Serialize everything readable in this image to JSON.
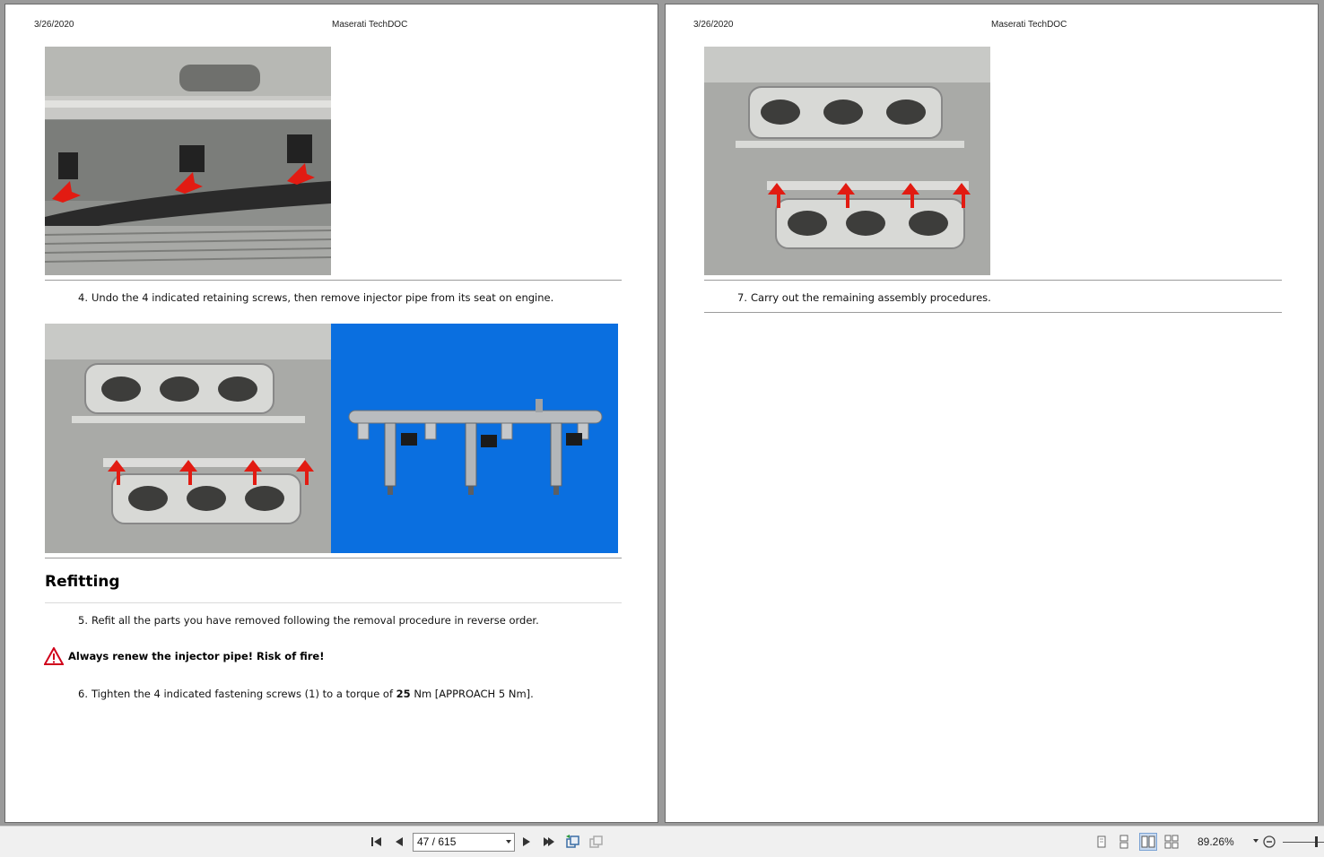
{
  "document": {
    "date": "3/26/2020",
    "title": "Maserati TechDOC"
  },
  "left_page": {
    "step4": {
      "number": "4.",
      "text": "Undo the 4 indicated retaining screws, then remove injector pipe from its seat on engine."
    },
    "section_title": "Refitting",
    "step5": {
      "number": "5.",
      "text": "Refit all the parts you have removed following the removal procedure in reverse order."
    },
    "warning": "Always renew the injector pipe! Risk of fire!",
    "step6": {
      "number": "6.",
      "pre": "Tighten the 4 indicated fastening screws (1) to a torque of ",
      "bold": "25",
      "post": " Nm [APPROACH 5 Nm]."
    }
  },
  "right_page": {
    "step7": {
      "number": "7.",
      "text": "Carry out the remaining assembly procedures."
    }
  },
  "toolbar": {
    "page_indicator": "47 / 615",
    "zoom": "89.26%",
    "icons": [
      "first-page-icon",
      "prev-page-icon",
      "next-page-icon",
      "last-page-icon",
      "previous-view-icon",
      "next-view-icon",
      "single-page-icon",
      "continuous-icon",
      "facing-icon",
      "continuous-facing-icon",
      "zoom-out-icon"
    ]
  },
  "colors": {
    "accent_arrow": "#e21b12",
    "photo_blue_bg": "#0a6fe0",
    "warning_red": "#d0021b"
  }
}
